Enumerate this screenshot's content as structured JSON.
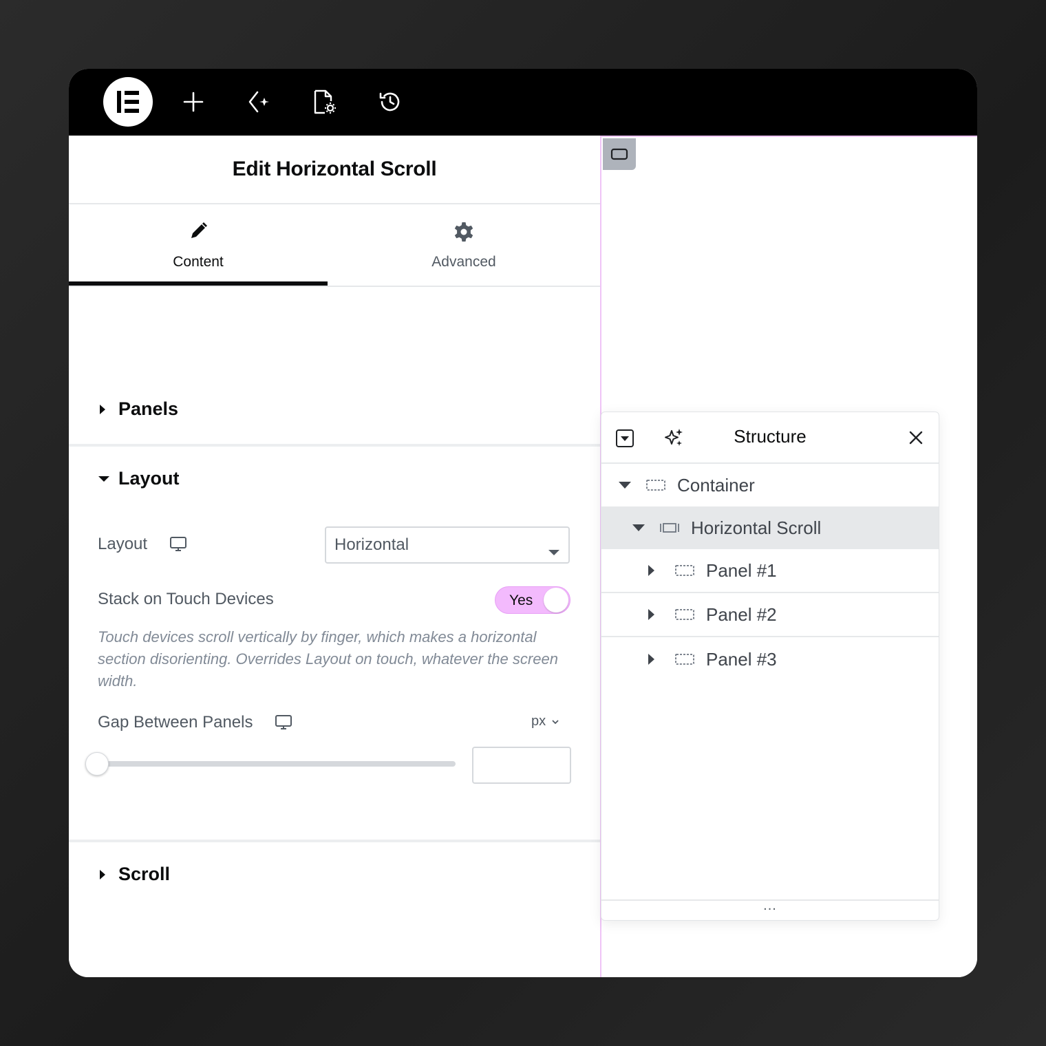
{
  "panel": {
    "title": "Edit Horizontal Scroll",
    "tabs": [
      {
        "label": "Content",
        "icon": "pencil-icon",
        "active": true
      },
      {
        "label": "Advanced",
        "icon": "gear-icon",
        "active": false
      }
    ],
    "sections": {
      "panels": {
        "label": "Panels",
        "expanded": false
      },
      "layout": {
        "label": "Layout",
        "expanded": true
      },
      "scroll": {
        "label": "Scroll",
        "expanded": false
      }
    },
    "layout_control": {
      "label": "Layout",
      "value": "Horizontal"
    },
    "stack_control": {
      "label": "Stack on Touch Devices",
      "toggle_label": "Yes",
      "description": "Touch devices scroll vertically by finger, which makes a horizontal section disorienting. Overrides Layout on touch, whatever the screen width."
    },
    "gap_control": {
      "label": "Gap Between Panels",
      "unit": "px",
      "slider_value": 0,
      "value": ""
    }
  },
  "structure": {
    "title": "Structure",
    "tree": [
      {
        "label": "Container",
        "level": 0,
        "expanded": true,
        "selected": false
      },
      {
        "label": "Horizontal Scroll",
        "level": 1,
        "expanded": true,
        "selected": true
      },
      {
        "label": "Panel #1",
        "level": 2,
        "expanded": false,
        "selected": false
      },
      {
        "label": "Panel #2",
        "level": 2,
        "expanded": false,
        "selected": false
      },
      {
        "label": "Panel #3",
        "level": 2,
        "expanded": false,
        "selected": false
      }
    ],
    "footer": "..."
  },
  "colors": {
    "accent_pink": "#f3bafd",
    "canvas_outline": "#efc4f7",
    "topbar": "#000000"
  }
}
